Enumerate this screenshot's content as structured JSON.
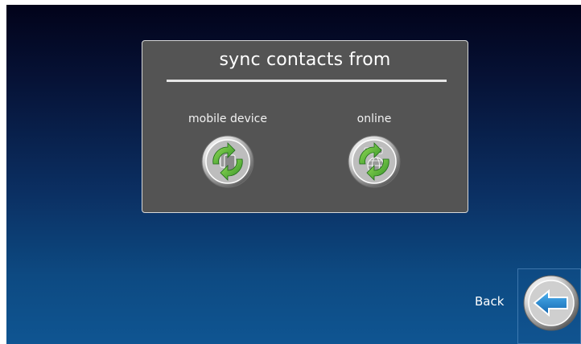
{
  "dialog": {
    "title": "sync contacts from",
    "options": [
      {
        "label": "mobile device",
        "icon": "phone-sync-icon"
      },
      {
        "label": "online",
        "icon": "globe-sync-icon"
      }
    ]
  },
  "navigation": {
    "back_label": "Back",
    "back_icon": "back-arrow-icon"
  },
  "colors": {
    "background_top": "#02031a",
    "background_bottom": "#0f5592",
    "dialog_bg": "#545454",
    "sync_arrow_green": "#4caf36",
    "back_arrow_blue": "#1e8ad6"
  }
}
